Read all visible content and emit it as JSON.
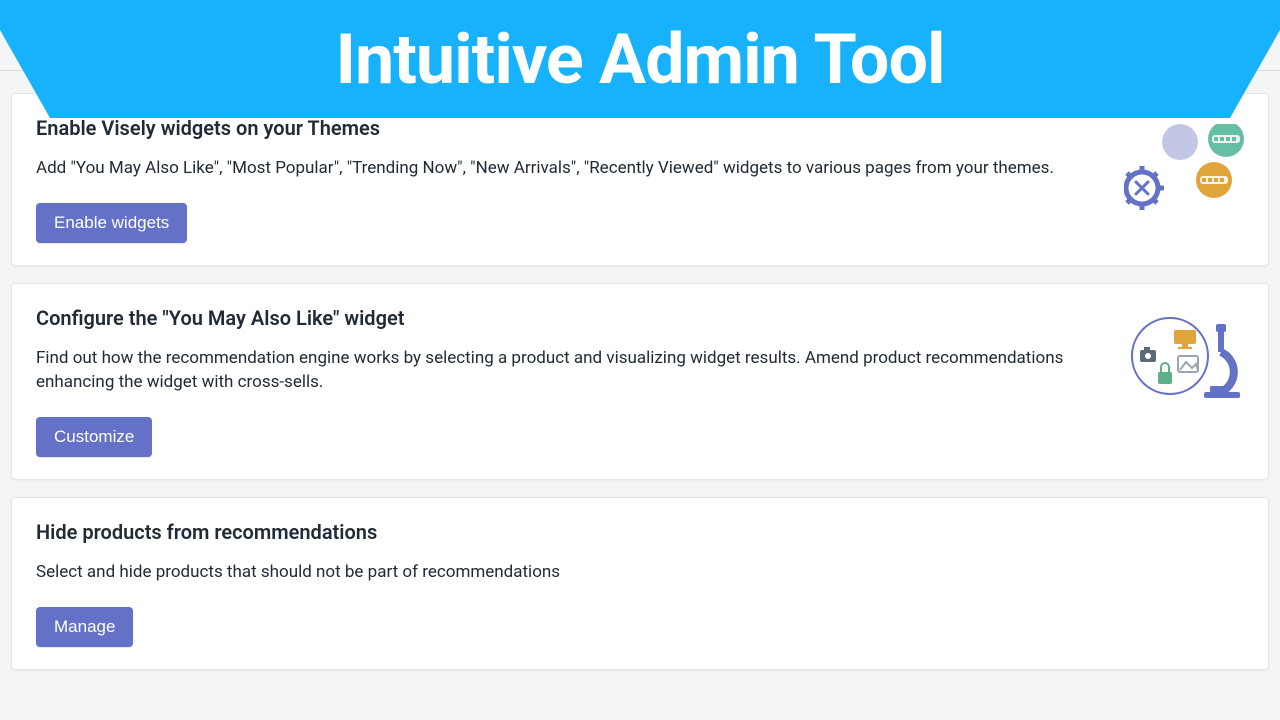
{
  "banner": {
    "title": "Intuitive Admin Tool"
  },
  "cards": [
    {
      "title": "Enable Visely widgets on your Themes",
      "desc": "Add \"You May Also Like\", \"Most Popular\", \"Trending Now\", \"New Arrivals\", \"Recently Viewed\" widgets to various pages from your themes.",
      "button": "Enable widgets"
    },
    {
      "title": "Configure the \"You May Also Like\" widget",
      "desc": "Find out how the recommendation engine works by selecting a product and visualizing widget results. Amend product recommendations enhancing the widget with cross-sells.",
      "button": "Customize"
    },
    {
      "title": "Hide products from recommendations",
      "desc": "Select and hide products that should not be part of recommendations",
      "button": "Manage"
    }
  ],
  "colors": {
    "banner": "#17b1fc",
    "button": "#6371c7"
  }
}
